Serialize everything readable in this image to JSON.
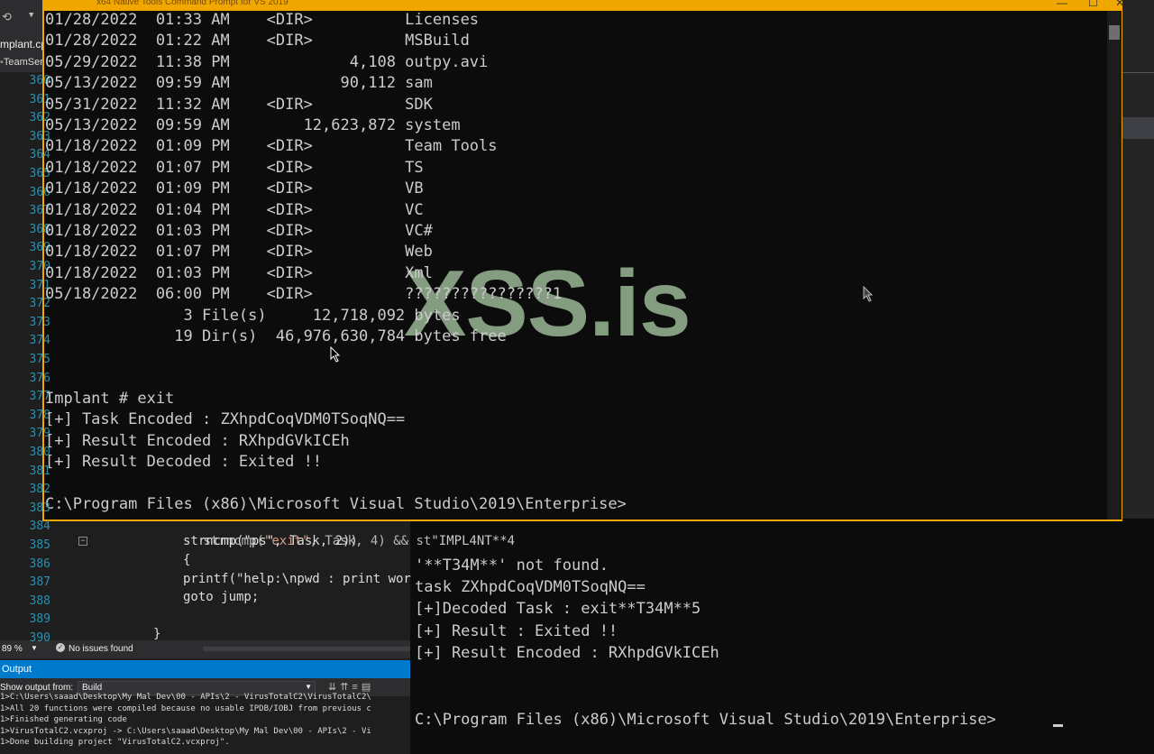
{
  "vs": {
    "file_tab": "mplant.cpp",
    "team_tab": "TeamServ",
    "line_numbers": [
      "360",
      "361",
      "362",
      "363",
      "364",
      "365",
      "366",
      "367",
      "368",
      "369",
      "370",
      "371",
      "372",
      "373",
      "374",
      "375",
      "376",
      "377",
      "378",
      "379",
      "380",
      "381",
      "382",
      "383",
      "384",
      "385",
      "386",
      "387",
      "388",
      "389",
      "390"
    ],
    "code_lines": [
      {
        "n": "384",
        "text": "strncmp(\"exit\", Task, 4) && st"
      },
      {
        "n": "385",
        "text": "strncmp(\"ps\", Task, 2))"
      },
      {
        "n": "386",
        "text": "{"
      },
      {
        "n": "387",
        "text": "printf(\"help:\\npwd : print wor"
      },
      {
        "n": "388",
        "text": "goto jump;"
      },
      {
        "n": "390",
        "text": "}"
      }
    ],
    "zoom": "89 %",
    "issues": "No issues found",
    "output_title": "Output",
    "show_output_label": "Show output from:",
    "show_output_value": "Build",
    "output_lines": [
      "1>C:\\Users\\saaad\\Desktop\\My Mal Dev\\00 - APIs\\2 - VirusTotalC2\\VirusTotalC2\\",
      "1>All 20 functions were compiled because no usable IPDB/IOBJ from previous c",
      "1>Finished generating code",
      "1>VirusTotalC2.vcxproj -> C:\\Users\\saaad\\Desktop\\My Mal Dev\\00 - APIs\\2 - Vi",
      "1>Done building project \"VirusTotalC2.vcxproj\"."
    ]
  },
  "console": {
    "title": "x64 Native Tools Command Prompt for VS 2019",
    "listing": [
      "01/28/2022  01:33 AM    <DIR>          Licenses",
      "01/28/2022  01:22 AM    <DIR>          MSBuild",
      "05/29/2022  11:38 PM             4,108 outpy.avi",
      "05/13/2022  09:59 AM            90,112 sam",
      "05/31/2022  11:32 AM    <DIR>          SDK",
      "05/13/2022  09:59 AM        12,623,872 system",
      "01/18/2022  01:09 PM    <DIR>          Team Tools",
      "01/18/2022  01:07 PM    <DIR>          TS",
      "01/18/2022  01:09 PM    <DIR>          VB",
      "01/18/2022  01:04 PM    <DIR>          VC",
      "01/18/2022  01:03 PM    <DIR>          VC#",
      "01/18/2022  01:07 PM    <DIR>          Web",
      "01/18/2022  01:03 PM    <DIR>          Xml",
      "05/18/2022  06:00 PM    <DIR>          ????????????????1",
      "               3 File(s)     12,718,092 bytes",
      "              19 Dir(s)  46,976,630,784 bytes free"
    ],
    "session": [
      "Implant # exit",
      "[+] Task Encoded : ZXhpdCoqVDM0TSoqNQ==",
      "[+] Result Encoded : RXhpdGVkICEh",
      "[+] Result Decoded : Exited !!"
    ],
    "prompt": "C:\\Program Files (x86)\\Microsoft Visual Studio\\2019\\Enterprise>"
  },
  "lower_console": {
    "lines": [
      "'**T34M**' not found.",
      "task ZXhpdCoqVDM0TSoqNQ==",
      "[+]Decoded Task : exit**T34M**5",
      "[+] Result : Exited !!",
      "[+] Result Encoded : RXhpdGVkICEh"
    ],
    "partial_top": "\"IMPL4NT**4",
    "prompt": "C:\\Program Files (x86)\\Microsoft Visual Studio\\2019\\Enterprise>"
  },
  "watermark": "XSS.is",
  "colors": {
    "console_border": "#f0a700",
    "watermark": "#8faa8a",
    "vs_accent": "#007acc"
  }
}
